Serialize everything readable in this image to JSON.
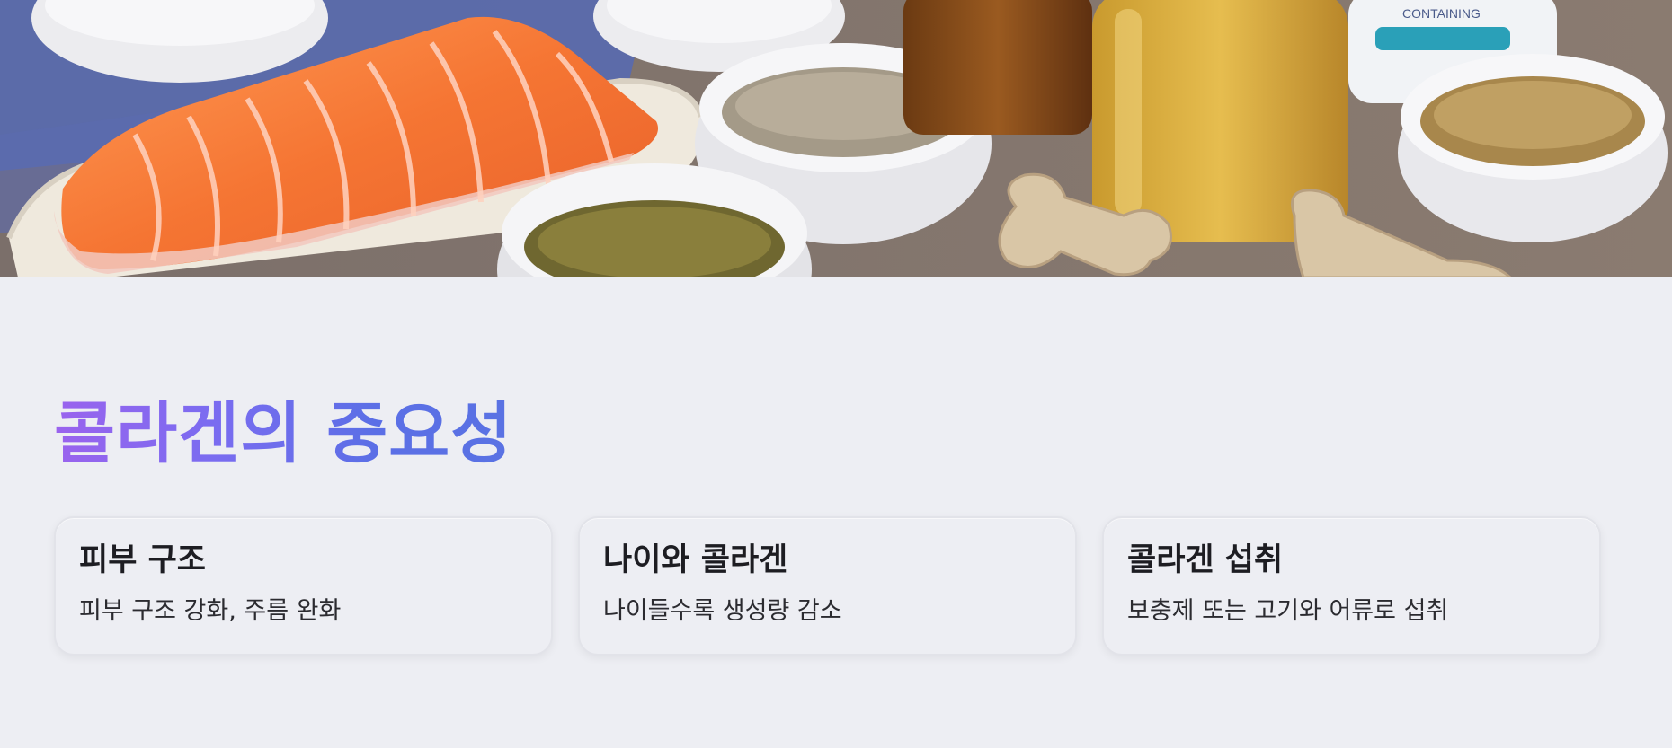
{
  "hero": {
    "image_subject": "salmon-fillet-collagen-foods-photo",
    "colors": {
      "salmon": "#f47a3a",
      "cloth": "#5b6db0",
      "table": "#8d7e74"
    }
  },
  "section": {
    "title": "콜라겐의 중요성",
    "title_gradient": [
      "#9a63ee",
      "#5a72e3"
    ]
  },
  "cards": [
    {
      "title": "피부 구조",
      "desc": "피부 구조 강화, 주름 완화"
    },
    {
      "title": "나이와 콜라겐",
      "desc": "나이들수록 생성량 감소"
    },
    {
      "title": "콜라겐 섭취",
      "desc": "보충제 또는 고기와 어류로 섭취"
    }
  ]
}
